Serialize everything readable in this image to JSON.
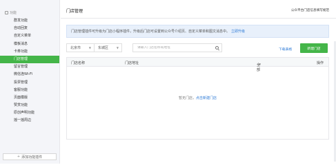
{
  "sidebar": {
    "section_title": "功能",
    "items": [
      {
        "label": "群发功能",
        "active": false
      },
      {
        "label": "自动回复",
        "active": false
      },
      {
        "label": "自定义菜单",
        "active": false
      },
      {
        "label": "模板消息",
        "active": false
      },
      {
        "label": "卡券功能",
        "active": false
      },
      {
        "label": "门店管理",
        "active": true
      },
      {
        "label": "留言管理",
        "active": false
      },
      {
        "label": "微信连Wi-Fi",
        "active": false
      },
      {
        "label": "投票管理",
        "active": false
      },
      {
        "label": "客服功能",
        "active": false
      },
      {
        "label": "页面模版",
        "active": false
      },
      {
        "label": "赞赏功能",
        "active": false
      },
      {
        "label": "原创声明功能",
        "active": false
      },
      {
        "label": "摇一摇周边",
        "active": false
      }
    ],
    "add_plugin_label": "添加功能插件",
    "add_plugin_icon": "plus-icon"
  },
  "header": {
    "title": "门店管理",
    "top_link": "公众平台门店信息填写规范"
  },
  "notice": {
    "text": "门店管理插件可升级为门店小程序插件，升级后门店可设置到公众号介绍页、自定义菜单和图文消息中。",
    "link_text": "立即升级"
  },
  "filters": {
    "province": "北京市",
    "district": "东城区",
    "search_placeholder": "请输入门店名称或地址",
    "search_value": ""
  },
  "actions": {
    "download_label": "下载表格",
    "new_store_label": "新建门店"
  },
  "table": {
    "columns": {
      "name": "门店名称",
      "address": "门店地址",
      "status": "全部",
      "operation": "操作"
    },
    "empty_text": "暂无门店，",
    "empty_link": "点击新建门店"
  },
  "colors": {
    "accent_green": "#44b549",
    "link_blue": "#2d7ad6",
    "sidebar_bg": "#f4f5f9",
    "notice_bg": "#e8f0fb"
  }
}
